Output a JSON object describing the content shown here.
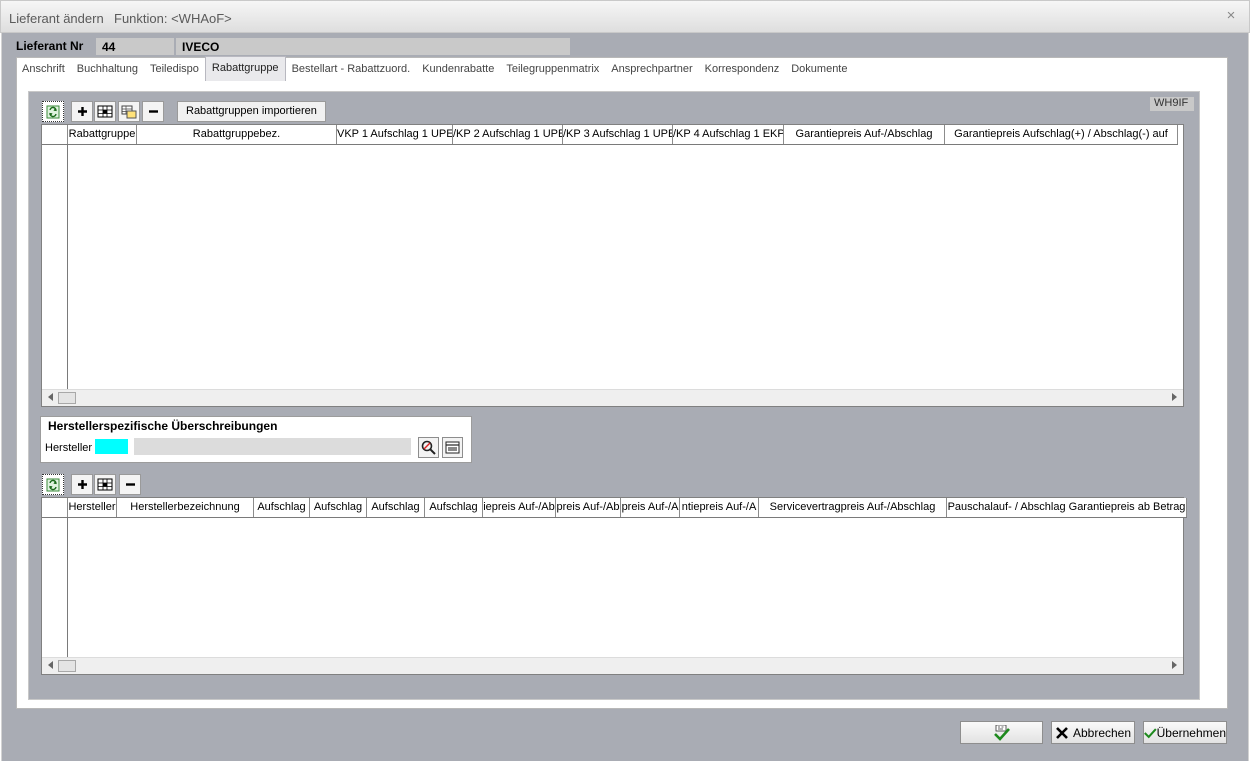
{
  "window": {
    "title": "Lieferant ändern",
    "function_label": "Funktion: <WHAoF>",
    "close_glyph": "×"
  },
  "header": {
    "lieferant_label": "Lieferant Nr",
    "lieferant_nr": "44",
    "lieferant_name": "IVECO"
  },
  "tabs": [
    {
      "label": "Anschrift"
    },
    {
      "label": "Buchhaltung"
    },
    {
      "label": "Teiledispo"
    },
    {
      "label": "Rabattgruppe",
      "active": true
    },
    {
      "label": "Bestellart - Rabattzuord."
    },
    {
      "label": "Kundenrabatte"
    },
    {
      "label": "Teilegruppenmatrix"
    },
    {
      "label": "Ansprechpartner"
    },
    {
      "label": "Korrespondenz"
    },
    {
      "label": "Dokumente"
    }
  ],
  "toolbar_top": {
    "import_label": "Rabattgruppen importieren",
    "badge": "WH9IF"
  },
  "grid_top": {
    "columns": [
      "Rabattgruppe",
      "Rabattgruppebez.",
      "VKP 1 Aufschlag 1 UPE",
      "/KP 2 Aufschlag 1 UPE",
      "/KP 3 Aufschlag 1 UPE",
      "/KP 4 Aufschlag 1 EKP",
      "Garantiepreis Auf-/Abschlag",
      "Garantiepreis Aufschlag(+) / Abschlag(-) auf"
    ]
  },
  "hersteller": {
    "title": "Herstellerspezifische Überschreibungen",
    "label": "Hersteller",
    "code_color": "#00ffff"
  },
  "grid_bottom": {
    "columns": [
      "Hersteller",
      "Herstellerbezeichnung",
      "Aufschlag",
      "Aufschlag",
      "Aufschlag",
      "Aufschlag",
      "iepreis Auf-/Ab",
      "preis Auf-/Ab",
      "preis Auf-/A",
      "ntiepreis Auf-/A",
      "Servicevertragpreis Auf-/Abschlag",
      "Pauschalauf- / Abschlag Garantiepreis ab Betrag"
    ]
  },
  "buttons": {
    "ok_label": "",
    "cancel_label": "Abbrechen",
    "apply_label": "Übernehmen"
  },
  "icons": {
    "refresh": "refresh-icon",
    "add": "plus-icon",
    "edit": "edit-grid-icon",
    "copy": "copy-grid-icon",
    "delete": "minus-icon",
    "search": "search-icon",
    "list": "list-icon",
    "ok": "ok-check-icon",
    "cancel": "x-icon",
    "apply": "check-icon"
  }
}
